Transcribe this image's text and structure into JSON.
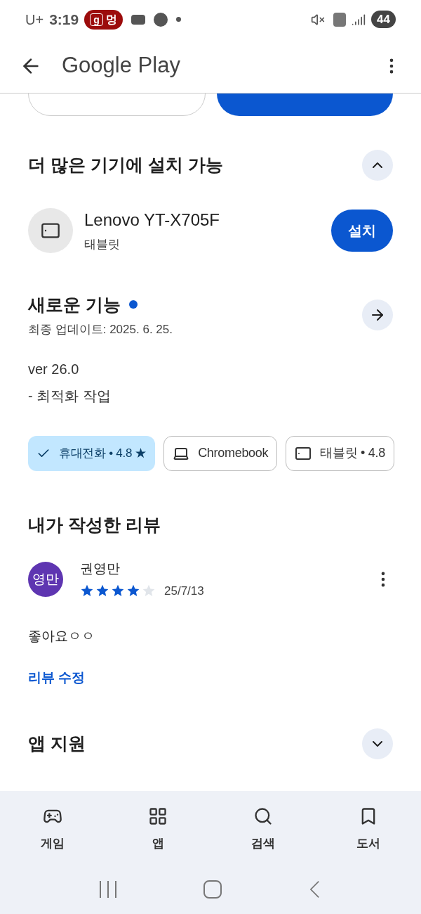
{
  "status_bar": {
    "carrier": "U+",
    "time": "3:19",
    "badge_letter": "g",
    "badge_text": "멍",
    "battery": "44"
  },
  "app_bar": {
    "title": "Google Play"
  },
  "install_more": {
    "title": "더 많은 기기에 설치 가능",
    "expanded": true,
    "device": {
      "name": "Lenovo YT-X705F",
      "type": "태블릿",
      "button": "설치"
    }
  },
  "whats_new": {
    "title": "새로운 기능",
    "updated": "최종 업데이트: 2025. 6. 25.",
    "lines": [
      "ver 26.0",
      "- 최적화 작업"
    ]
  },
  "device_chips": [
    {
      "kind": "phone",
      "label": "휴대전화 • 4.8 ★",
      "selected": true
    },
    {
      "kind": "laptop",
      "label": "Chromebook",
      "selected": false
    },
    {
      "kind": "tablet",
      "label": "태블릿 • 4.8",
      "selected": false
    }
  ],
  "my_review": {
    "title": "내가 작성한 리뷰",
    "avatar": "영만",
    "author": "권영만",
    "stars": 4,
    "date": "25/7/13",
    "text": "좋아요ㅇㅇ",
    "edit_link": "리뷰 수정"
  },
  "app_support": {
    "title": "앱 지원",
    "expanded": false
  },
  "bottom_nav": [
    {
      "kind": "games",
      "label": "게임",
      "selected": false
    },
    {
      "kind": "apps",
      "label": "앱",
      "selected": false
    },
    {
      "kind": "search",
      "label": "검색",
      "selected": false
    },
    {
      "kind": "books",
      "label": "도서",
      "selected": false
    }
  ]
}
